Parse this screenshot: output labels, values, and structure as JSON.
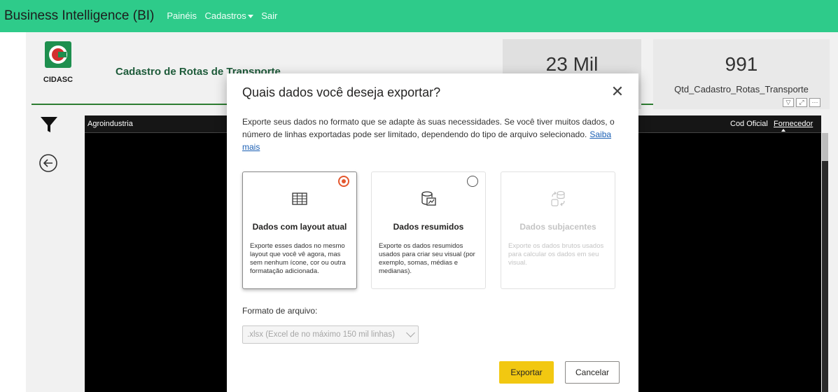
{
  "topbar": {
    "brand": "Business Intelligence (BI)",
    "nav": [
      "Painéis",
      "Cadastros",
      "Sair"
    ]
  },
  "report": {
    "logo_text": "CIDASC",
    "title": "Cadastro de Rotas de Transporte",
    "kpi1": {
      "value": "23 Mil"
    },
    "kpi2": {
      "value": "991",
      "label": "Qtd_Cadastro_Rotas_Transporte"
    },
    "table": {
      "col_first": "Agroindustria",
      "col_cod": "Cod Oficial",
      "col_fornecedor": "Fornecedor"
    }
  },
  "dialog": {
    "title": "Quais dados você deseja exportar?",
    "description": "Exporte seus dados no formato que se adapte às suas necessidades. Se você tiver muitos dados, o número de linhas exportadas pode ser limitado, dependendo do tipo de arquivo selecionado.",
    "link": "Saiba mais",
    "options": [
      {
        "title": "Dados com layout atual",
        "desc": "Exporte esses dados no mesmo layout que você vê agora, mas sem nenhum ícone, cor ou outra formatação adicionada.",
        "icon": "table-icon",
        "selected": true
      },
      {
        "title": "Dados resumidos",
        "desc": "Exporte os dados resumidos usados para criar seu visual (por exemplo, somas, médias e medianas).",
        "icon": "summarized-data-icon",
        "selected": false
      },
      {
        "title": "Dados subjacentes",
        "desc": "Exporte os dados brutos usados para calcular os dados em seu visual.",
        "icon": "underlying-data-icon",
        "selected": false
      }
    ],
    "format_label": "Formato de arquivo:",
    "format_value": ".xlsx (Excel de no máximo 150 mil linhas)",
    "export_label": "Exportar",
    "cancel_label": "Cancelar"
  },
  "colors": {
    "topbar": "#2ecb8a",
    "title_green": "#1e5b3a",
    "selected_radio": "#e4572e",
    "export_button": "#f2c811"
  }
}
